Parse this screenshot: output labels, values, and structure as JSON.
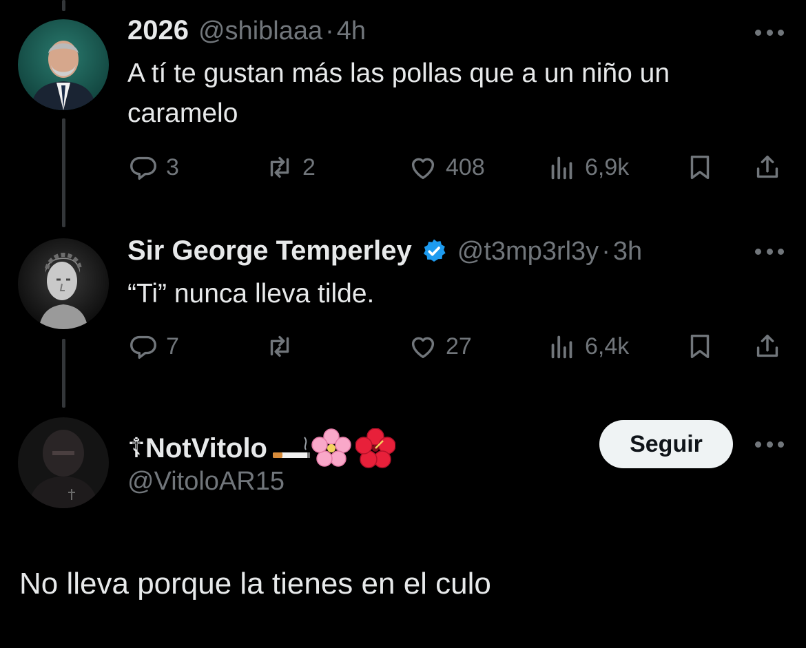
{
  "tweets": [
    {
      "name": "2026",
      "handle": "@shiblaaa",
      "separator": "·",
      "time": "4h",
      "text": "A tí te gustan más las pollas que a un niño un caramelo",
      "replies": "3",
      "retweets": "2",
      "likes": "408",
      "views": "6,9k"
    },
    {
      "name": "Sir George Temperley",
      "handle": "@t3mp3rl3y",
      "separator": "·",
      "time": "3h",
      "text": "“Ti” nunca lleva tilde.",
      "replies": "7",
      "retweets": "",
      "likes": "27",
      "views": "6,4k"
    }
  ],
  "main_post": {
    "name": "☦NotVitolo",
    "handle": "@VitoloAR15",
    "follow_label": "Seguir",
    "text": "No lleva porque la tienes en el culo",
    "name_emojis": [
      "cigarette-emoji",
      "cherry-blossom-emoji",
      "hibiscus-emoji"
    ]
  },
  "colors": {
    "background": "#000000",
    "text": "#e7e9ea",
    "muted": "#71767b",
    "verified": "#1d9bf0",
    "button_bg": "#eff3f4"
  },
  "icons": [
    "reply-icon",
    "retweet-icon",
    "like-icon",
    "views-icon",
    "bookmark-icon",
    "share-icon",
    "more-icon",
    "verified-icon"
  ]
}
